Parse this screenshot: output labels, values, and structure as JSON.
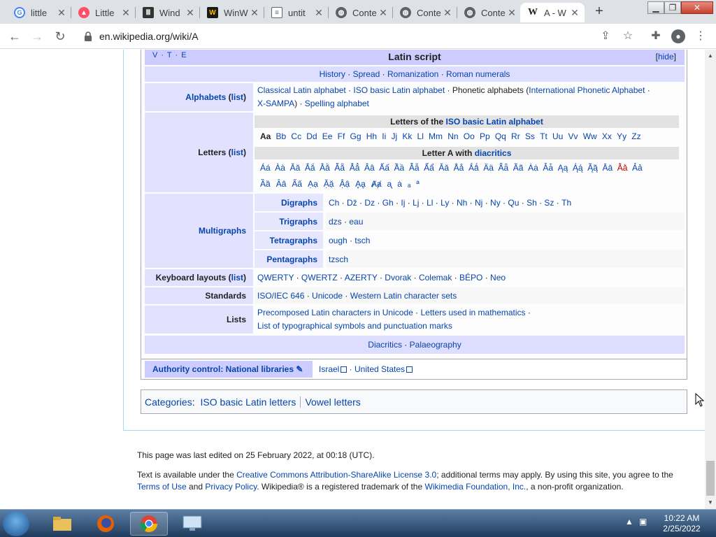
{
  "browser": {
    "tabs": [
      {
        "title": "little",
        "icon": "google-g-icon",
        "color": "#4285f4"
      },
      {
        "title": "Little",
        "icon": "tinder-flame-icon",
        "color": "#fd5068"
      },
      {
        "title": "Wind",
        "icon": "museum-icon",
        "color": "#333333"
      },
      {
        "title": "WinW",
        "icon": "w-logo-icon",
        "color": "#1a1a1a"
      },
      {
        "title": "untit",
        "icon": "document-icon",
        "color": "#5f6368"
      },
      {
        "title": "Conte",
        "icon": "globe-icon",
        "color": "#5f6368"
      },
      {
        "title": "Conte",
        "icon": "globe-icon",
        "color": "#5f6368"
      },
      {
        "title": "Conte",
        "icon": "globe-icon",
        "color": "#5f6368"
      },
      {
        "title": "A - W",
        "icon": "wikipedia-w-icon",
        "color": "#202122"
      }
    ],
    "url": "en.wikipedia.org/wiki/A"
  },
  "navbox": {
    "vte": "V · T · E",
    "title": "Latin script",
    "hide_label": "hide",
    "top_links": [
      "History",
      "Spread",
      "Romanization",
      "Roman numerals"
    ],
    "alphabets": {
      "label": "Alphabets",
      "list_label": "list",
      "line1_links": [
        "Classical Latin alphabet",
        "ISO basic Latin alphabet"
      ],
      "line1_plain": "Phonetic alphabets",
      "line1_paren_link": "International Phonetic Alphabet",
      "line2_links": [
        "X-SAMPA",
        "Spelling alphabet"
      ]
    },
    "letters": {
      "label": "Letters",
      "list_label": "list",
      "subhead1_prefix": "Letters of the",
      "subhead1_link": "ISO basic Latin alphabet",
      "basic": [
        "Aa",
        "Bb",
        "Cc",
        "Dd",
        "Ee",
        "Ff",
        "Gg",
        "Hh",
        "Ii",
        "Jj",
        "Kk",
        "Ll",
        "Mm",
        "Nn",
        "Oo",
        "Pp",
        "Qq",
        "Rr",
        "Ss",
        "Tt",
        "Uu",
        "Vv",
        "Ww",
        "Xx",
        "Yy",
        "Zz"
      ],
      "subhead2_prefix": "Letter A with",
      "subhead2_link": "diacritics",
      "diacritics_row1": [
        "Áá",
        "Àà",
        "Ăă",
        "Ắắ",
        "Ằằ",
        "Ẵẵ",
        "Ẳẳ",
        "Ââ",
        "Ấấ",
        "Ầầ",
        "Ẫẫ",
        "Ẩẩ",
        "Ǎǎ",
        "Åå",
        "Ǻǻ",
        "Ää",
        "Ǟǟ",
        "Ãã",
        "Ȧȧ",
        "Ǡǡ",
        "Ąą",
        "Ą́ą́",
        "Ą̃ą̃",
        "Āā",
        "Ā̀ā̀",
        "Ảả"
      ],
      "diacritics_row2": [
        "Ȁȁ",
        "Ȃȃ",
        "A̋a̋",
        "Ạạ",
        "Ặặ",
        "Ậậ",
        "Ḁḁ",
        "Ⱥⱥ",
        "ᶏ",
        "ẚ",
        "ₐ",
        "ª"
      ]
    },
    "multigraphs": {
      "label": "Multigraphs",
      "rows": [
        {
          "label": "Digraphs",
          "items": [
            "Ch",
            "Dž",
            "Dz",
            "Gh",
            "Ij",
            "Lj",
            "Ll",
            "Ly",
            "Nh",
            "Nj",
            "Ny",
            "Qu",
            "Sh",
            "Sz",
            "Th"
          ]
        },
        {
          "label": "Trigraphs",
          "items": [
            "dzs",
            "eau"
          ]
        },
        {
          "label": "Tetragraphs",
          "items": [
            "ough",
            "tsch"
          ]
        },
        {
          "label": "Pentagraphs",
          "items": [
            "tzsch"
          ]
        }
      ]
    },
    "keyboard": {
      "label": "Keyboard layouts",
      "list_label": "list",
      "items": [
        "QWERTY",
        "QWERTZ",
        "AZERTY",
        "Dvorak",
        "Colemak",
        "BÉPO",
        "Neo"
      ]
    },
    "standards": {
      "label": "Standards",
      "items": [
        "ISO/IEC 646",
        "Unicode",
        "Western Latin character sets"
      ]
    },
    "lists": {
      "label": "Lists",
      "line1": [
        "Precomposed Latin characters in Unicode",
        "Letters used in mathematics"
      ],
      "line2": "List of typographical symbols and punctuation marks"
    },
    "bottom_links": [
      "Diacritics",
      "Palaeography"
    ]
  },
  "authority": {
    "label": "Authority control: National libraries",
    "links": [
      "Israel",
      "United States"
    ]
  },
  "categories": {
    "label": "Categories",
    "items": [
      "ISO basic Latin letters",
      "Vowel letters"
    ]
  },
  "footer": {
    "last_edited": "This page was last edited on 25 February 2022, at 00:18 (UTC).",
    "license_prefix": "Text is available under the",
    "license_link": "Creative Commons Attribution-ShareAlike License 3.0",
    "license_mid": "; additional terms may apply. By using this site, you agree to the",
    "terms_link": "Terms of Use",
    "and": "and",
    "privacy_link": "Privacy Policy",
    "trademark": ". Wikipedia® is a registered trademark of the",
    "foundation_link": "Wikimedia Foundation, Inc.",
    "org_suffix": ", a non-profit organization."
  },
  "taskbar": {
    "time": "10:22 AM",
    "date": "2/25/2022"
  }
}
